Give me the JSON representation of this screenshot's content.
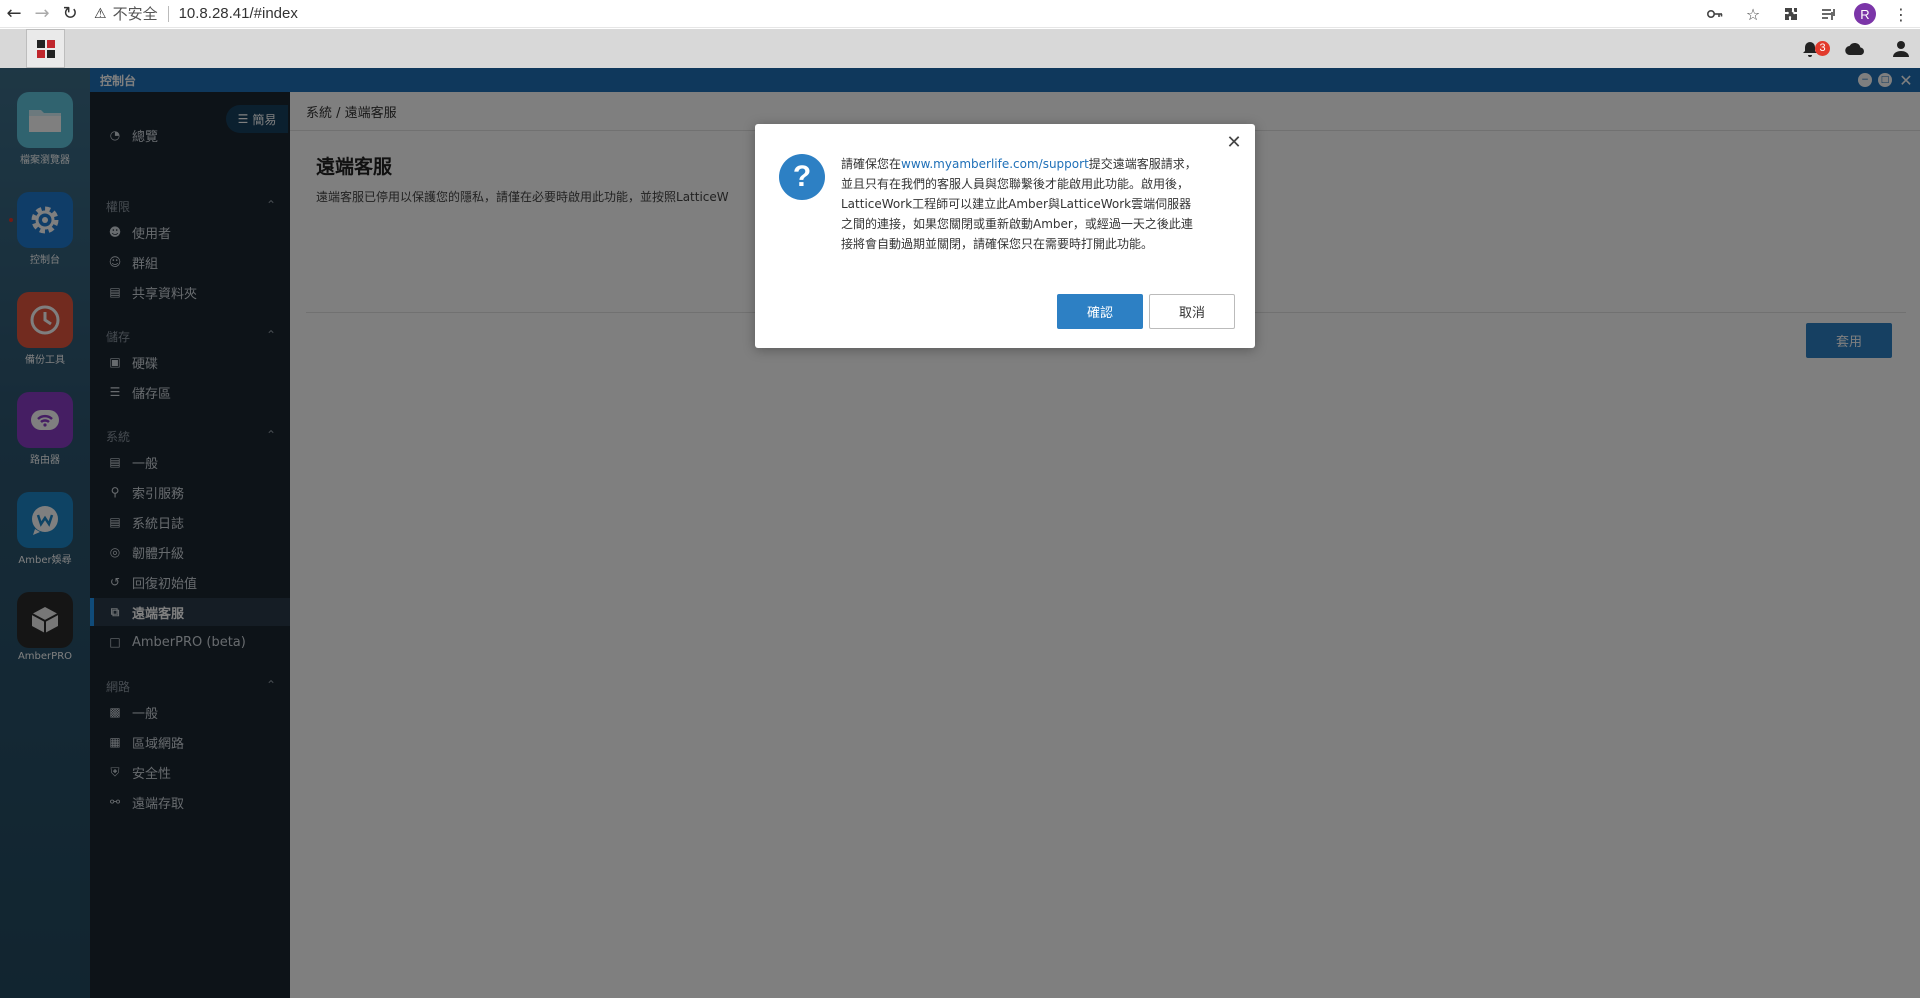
{
  "browser": {
    "insecure_label": "不安全",
    "url": "10.8.28.41/#index",
    "profile_initial": "R"
  },
  "nas_topbar": {
    "notification_count": "3"
  },
  "launcher": {
    "apps": [
      {
        "label": "檔案瀏覽器",
        "icon": "folder-icon",
        "color": "#5bc0d9"
      },
      {
        "label": "控制台",
        "icon": "gear-icon",
        "color": "#1e7bd1"
      },
      {
        "label": "備份工具",
        "icon": "clock-icon",
        "color": "#e4573f"
      },
      {
        "label": "路由器",
        "icon": "wifi-icon",
        "color": "#8a3cc6"
      },
      {
        "label": "Amber娛尋",
        "icon": "chat-icon",
        "color": "#1c86c9"
      },
      {
        "label": "AmberPRO",
        "icon": "box-icon",
        "color": "#2b2b2b"
      }
    ]
  },
  "window": {
    "title": "控制台",
    "mode_label": "簡易"
  },
  "sidebar": {
    "overview": "總覽",
    "sections": {
      "permission": "權限",
      "storage": "儲存",
      "system": "系統",
      "network": "網路"
    },
    "items": {
      "users": "使用者",
      "groups": "群組",
      "shared_folders": "共享資料夾",
      "disk": "硬碟",
      "storage_pool": "儲存區",
      "general": "一般",
      "indexing": "索引服務",
      "system_log": "系統日誌",
      "firmware": "韌體升級",
      "reset": "回復初始值",
      "remote_support": "遠端客服",
      "amberpro": "AmberPRO (beta)",
      "net_general": "一般",
      "lan": "區域網路",
      "security": "安全性",
      "remote_access": "遠端存取"
    }
  },
  "main": {
    "breadcrumb": "系統 / 遠端客服",
    "title": "遠端客服",
    "description": "遠端客服已停用以保護您的隱私，請僅在必要時啟用此功能，並按照LatticeW",
    "apply_label": "套用"
  },
  "dialog": {
    "msg_prefix": "請確保您在",
    "link": "www.myamberlife.com/support",
    "msg_suffix": "提交遠端客服請求，並且只有在我們的客服人員與您聯繫後才能啟用此功能。啟用後，LatticeWork工程師可以建立此Amber與LatticeWork雲端伺服器之間的連接，如果您關閉或重新啟動Amber，或經過一天之後此連接將會自動過期並關閉，請確保您只在需要時打開此功能。",
    "ok_label": "確認",
    "cancel_label": "取消"
  }
}
